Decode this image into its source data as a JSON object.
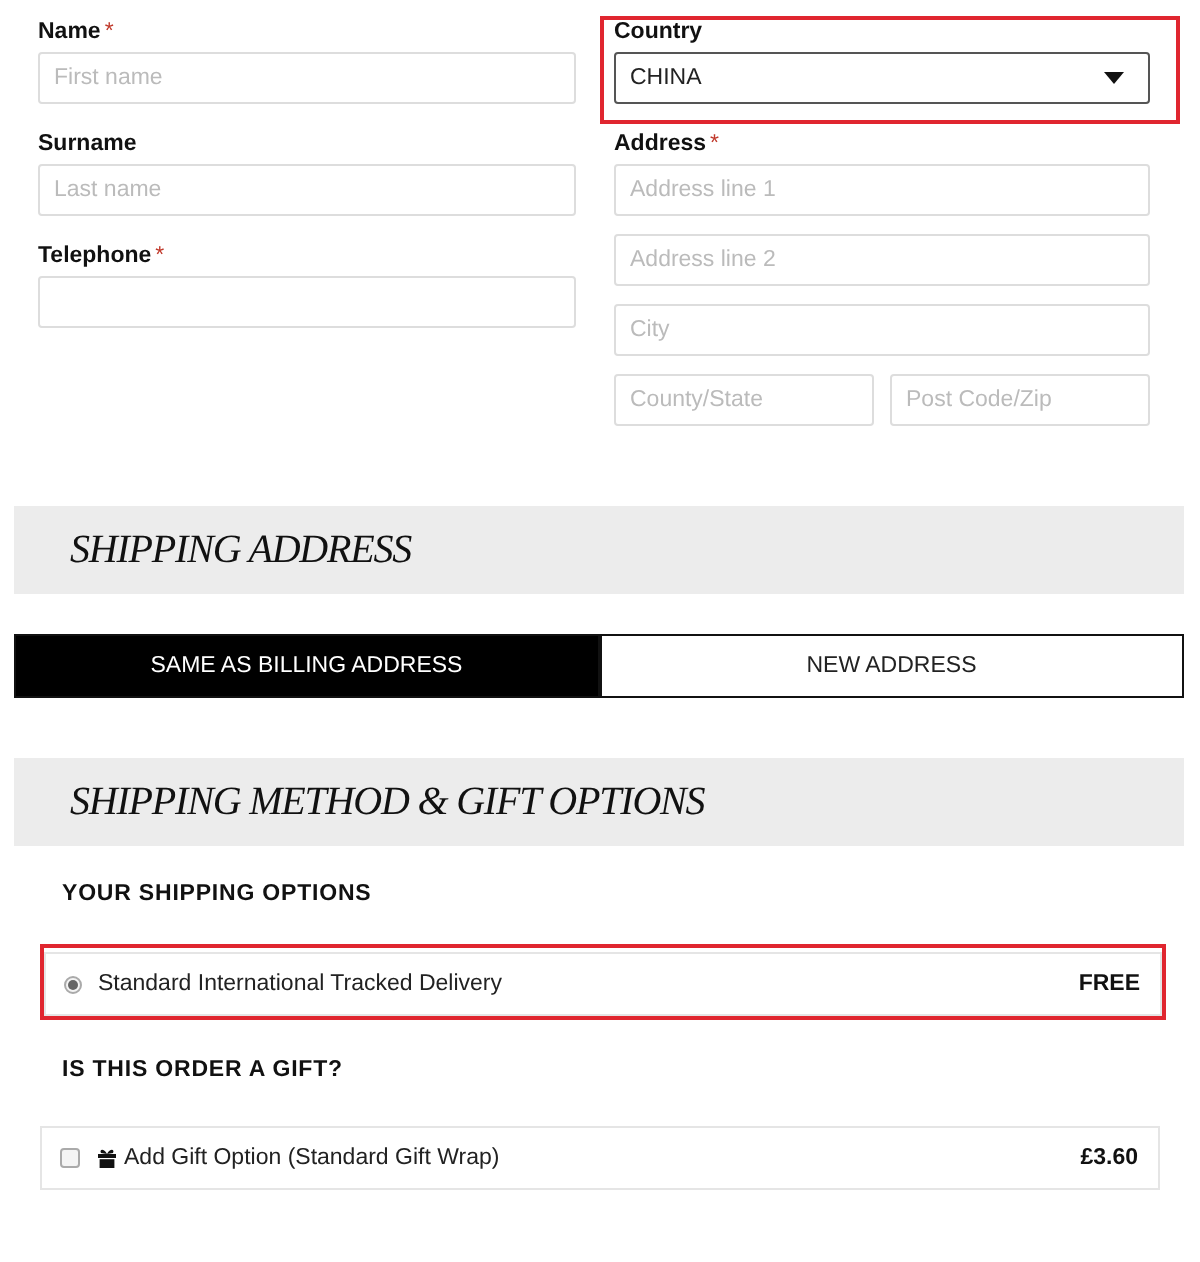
{
  "billing": {
    "columns": [
      [
        {
          "kind": "text",
          "label": "Name",
          "required_mark": "*",
          "highlighted": false,
          "rows": [
            [
              {
                "placeholder": "First name"
              }
            ]
          ]
        },
        {
          "kind": "text",
          "label": "Surname",
          "highlighted": false,
          "rows": [
            [
              {
                "placeholder": "Last name"
              }
            ]
          ]
        },
        {
          "kind": "text",
          "label": "Telephone",
          "required_mark": "*",
          "highlighted": false,
          "rows": [
            [
              {}
            ]
          ]
        }
      ],
      [
        {
          "kind": "select",
          "label": "Country",
          "highlighted": true,
          "value": "CHINA"
        },
        {
          "kind": "text",
          "label": "Address",
          "required_mark": "*",
          "highlighted": false,
          "rows": [
            [
              {
                "placeholder": "Address line 1"
              }
            ],
            [
              {
                "placeholder": "Address line 2"
              }
            ],
            [
              {
                "placeholder": "City"
              }
            ],
            [
              {
                "placeholder": "County/State"
              },
              {
                "placeholder": "Post Code/Zip"
              }
            ]
          ]
        }
      ]
    ]
  },
  "shipping_address": {
    "title": "SHIPPING ADDRESS",
    "choices": [
      {
        "label": "SAME AS BILLING ADDRESS",
        "selected": true
      },
      {
        "label": "NEW ADDRESS",
        "selected": false
      }
    ]
  },
  "shipping_method": {
    "title": "SHIPPING METHOD & GIFT OPTIONS",
    "options_heading": "YOUR SHIPPING OPTIONS",
    "options": [
      {
        "label": "Standard International Tracked Delivery",
        "price": "FREE",
        "selected": true,
        "highlighted": true
      }
    ],
    "gift_heading": "IS THIS ORDER A GIFT?",
    "gift": {
      "label": "Add Gift Option (Standard Gift Wrap)",
      "price": "£3.60",
      "checked": false
    }
  }
}
